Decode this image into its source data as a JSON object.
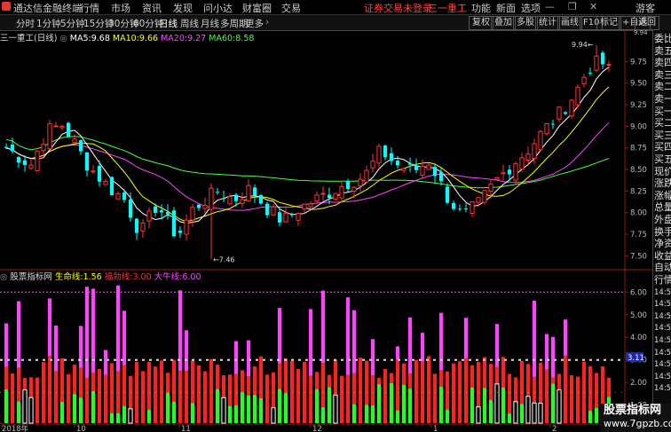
{
  "app": {
    "title": "通达信金融终端",
    "menu": [
      "行情",
      "市场",
      "资讯",
      "发现",
      "问小达",
      "财富圈",
      "交易"
    ],
    "login_notice": "证券交易未登录",
    "stock_name": "三一重工",
    "right_menu": [
      "功能",
      "新面",
      "选项",
      "游客"
    ],
    "window_icons": [
      "minimize-icon",
      "restore-icon",
      "close-icon"
    ]
  },
  "toolbar": {
    "periods": [
      "分时",
      "1分钟",
      "5分钟",
      "15分钟",
      "30分钟",
      "60分钟",
      "日线",
      "周线",
      "月线",
      "多周期",
      "更多"
    ],
    "active_period": "日线",
    "right_buttons": [
      "复权",
      "叠加",
      "多股",
      "统计",
      "画线",
      "F10",
      "标记",
      "+自选",
      "返回"
    ]
  },
  "infobar": {
    "stock_label": "三一重工(日线)",
    "ma": [
      {
        "name": "MA5:",
        "value": "9.68",
        "color": "#ffffff"
      },
      {
        "name": "MA10:",
        "value": "9.66",
        "color": "#ffff00"
      },
      {
        "name": "MA20:",
        "value": "9.27",
        "color": "#ff44ff"
      },
      {
        "name": "MA60:",
        "value": "8.58",
        "color": "#44ff44"
      }
    ]
  },
  "indicator_bar": {
    "name": "股票指标网",
    "items": [
      {
        "label": "生命线:",
        "value": "1.56",
        "color": "#ffff00"
      },
      {
        "label": "福勃线:",
        "value": "3.00",
        "color": "#ff3333"
      },
      {
        "label": "大牛线:",
        "value": "6.00",
        "color": "#ff44ff"
      }
    ]
  },
  "price_axis": [
    "9.75",
    "9.50",
    "9.25",
    "9.00",
    "8.75",
    "8.50",
    "8.25",
    "8.00",
    "7.75",
    "7.50"
  ],
  "indicator_axis": [
    "6.00",
    "5.00",
    "4.00",
    "3.00",
    "2.00",
    "1.00"
  ],
  "indicator_current": "3.11",
  "top_right_price": "9.94",
  "high_mark": "9.94",
  "low_mark": "7.46",
  "date_axis": [
    "2018年",
    "10",
    "11",
    "12",
    "1",
    "2"
  ],
  "sidebar": [
    "委比",
    "卖五",
    "卖四",
    "卖三",
    "卖二",
    "卖一",
    "买一",
    "买二",
    "买三",
    "买四",
    "买五",
    "现价",
    "涨跌",
    "涨幅",
    "总量",
    "外盘",
    "换手",
    "净资",
    "收益",
    "自动",
    "行情",
    "14:50",
    "14:50",
    "14:50",
    "14:50",
    "14:50",
    "14:50",
    "14:50",
    "14:50",
    "14:50"
  ],
  "watermark": {
    "line1": "股票指标网",
    "line2": "www.7gpzb.com"
  },
  "colors": {
    "up": "#ff3333",
    "down": "#00ffff",
    "ma5": "#ffffff",
    "ma10": "#ffff00",
    "ma20": "#ff44ff",
    "ma60": "#44ff44",
    "bull": "#ff44ff",
    "ind_red": "#ff2222",
    "ind_green": "#22ff22",
    "ind_white": "#ffffff"
  }
}
